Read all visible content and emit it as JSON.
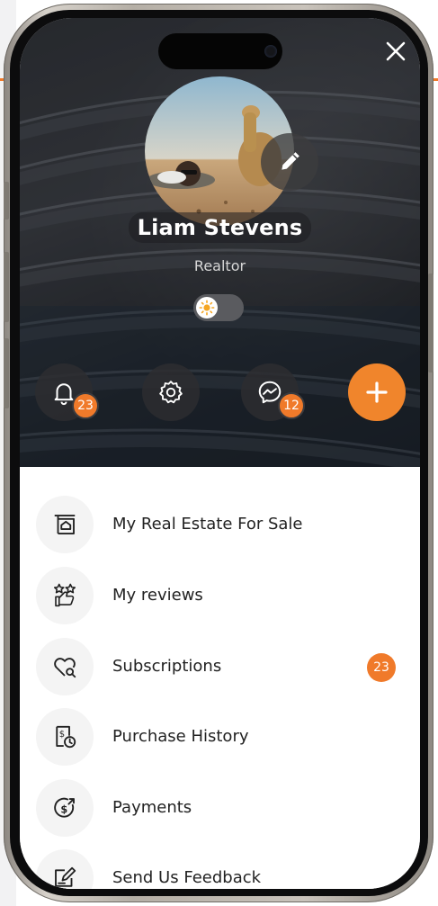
{
  "profile": {
    "name": "Liam Stevens",
    "role": "Realtor"
  },
  "theme_toggle": {
    "state": "light",
    "icon": "sun-icon"
  },
  "actions": {
    "notifications": {
      "icon": "bell-icon",
      "badge": "23"
    },
    "settings": {
      "icon": "gear-icon"
    },
    "messages": {
      "icon": "messenger-icon",
      "badge": "12"
    },
    "add": {
      "icon": "plus-icon"
    }
  },
  "menu": {
    "items": [
      {
        "label": "My Real Estate For Sale",
        "icon": "house-sign-icon"
      },
      {
        "label": "My reviews",
        "icon": "stars-thumbs-up-icon"
      },
      {
        "label": "Subscriptions",
        "icon": "heart-search-icon",
        "badge": "23"
      },
      {
        "label": "Purchase History",
        "icon": "receipt-clock-icon"
      },
      {
        "label": "Payments",
        "icon": "dollar-circle-icon"
      },
      {
        "label": "Send Us Feedback",
        "icon": "feedback-pen-icon"
      }
    ]
  },
  "colors": {
    "accent": "#f07a2a",
    "text": "#222222",
    "icon_bg": "#f4f4f4"
  }
}
